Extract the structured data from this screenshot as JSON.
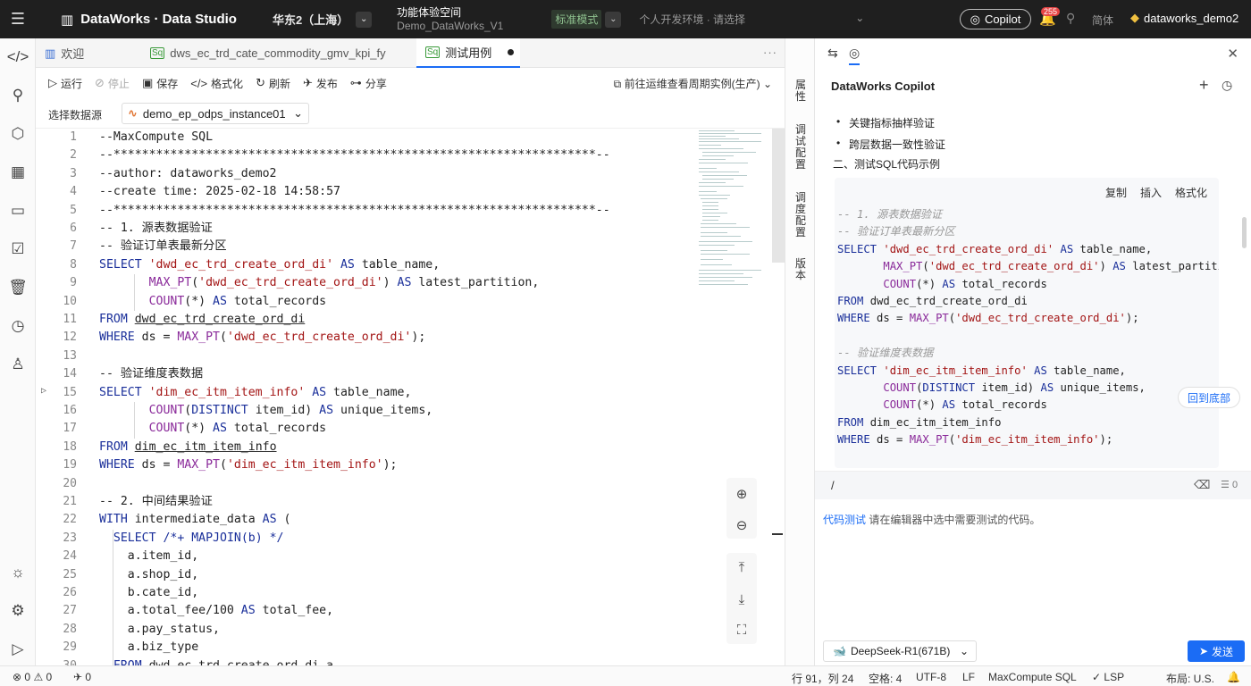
{
  "topbar": {
    "brand": "DataWorks · Data Studio",
    "region": "华东2（上海）",
    "workspace_name": "功能体验空间",
    "workspace_id": "Demo_DataWorks_V1",
    "mode": "标准模式",
    "env": "个人开发环境 · 请选择",
    "copilot": "Copilot",
    "notifications": "255",
    "lang": "简体",
    "user": "dataworks_demo2"
  },
  "tabs": [
    {
      "label": "欢迎"
    },
    {
      "label": "dws_ec_trd_cate_commodity_gmv_kpi_fy"
    },
    {
      "label": "测试用例"
    }
  ],
  "toolbar": {
    "run": "运行",
    "stop": "停止",
    "save": "保存",
    "format": "格式化",
    "refresh": "刷新",
    "publish": "发布",
    "share": "分享",
    "goto_ops": "前往运维查看周期实例(生产)"
  },
  "datasource": {
    "label": "选择数据源",
    "value": "demo_ep_odps_instance01"
  },
  "side_tabs": [
    "属性",
    "调试配置",
    "调度配置",
    "版本"
  ],
  "copilot": {
    "title": "DataWorks Copilot",
    "bullets": [
      "关键指标抽样验证",
      "跨层数据一致性验证"
    ],
    "section": "二、测试SQL代码示例",
    "actions": {
      "copy": "复制",
      "insert": "插入",
      "format": "格式化"
    },
    "back_to_bottom": "回到底部",
    "input_value": "/",
    "count": "0",
    "hint_link": "代码测试",
    "hint_text": "请在编辑器中选中需要测试的代码。",
    "model": "DeepSeek-R1(671B)",
    "send": "发送"
  },
  "statusbar": {
    "errors": "0",
    "warnings": "0",
    "ports": "0",
    "position": "行 91，列 24",
    "spaces": "空格: 4",
    "encoding": "UTF-8",
    "eol": "LF",
    "language": "MaxCompute SQL",
    "lsp": "LSP",
    "layout": "布局: U.S."
  }
}
